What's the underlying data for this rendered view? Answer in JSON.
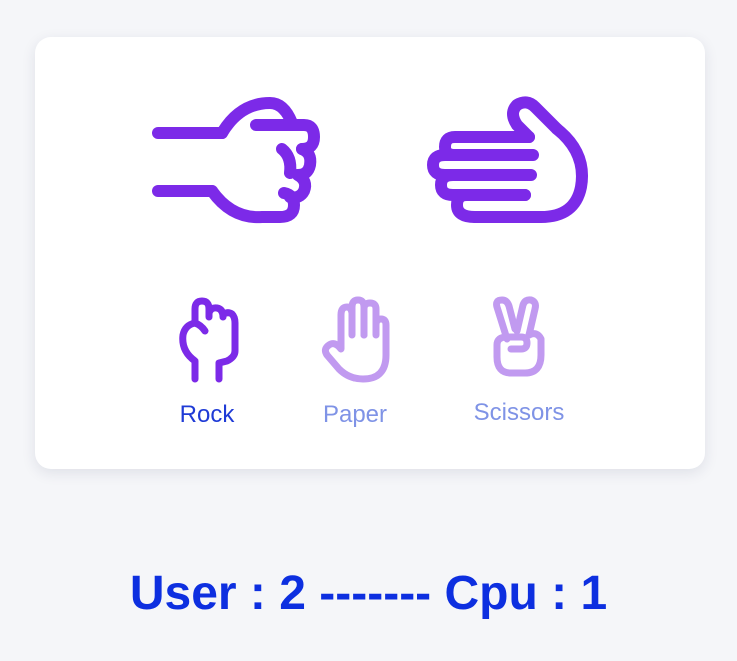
{
  "colors": {
    "hand_purple": "#7c2ae8",
    "hand_purple_light": "#c19af0",
    "label_selected": "#1f3bd6",
    "label_unselected": "#7f93e6",
    "score_text": "#0d2fe0",
    "background": "#f5f6f9",
    "card": "#ffffff"
  },
  "arena": {
    "user_hand_icon": "rock-fist-pointing-right-icon",
    "cpu_hand_icon": "paper-hand-pointing-left-icon"
  },
  "choices": [
    {
      "id": "rock",
      "label": "Rock",
      "icon": "rock-fist-icon",
      "selected": true
    },
    {
      "id": "paper",
      "label": "Paper",
      "icon": "paper-open-hand-icon",
      "selected": false
    },
    {
      "id": "scissors",
      "label": "Scissors",
      "icon": "scissors-peace-hand-icon",
      "selected": false
    }
  ],
  "score": {
    "text": "User : 2 ------- Cpu : 1",
    "user": 2,
    "cpu": 1
  }
}
